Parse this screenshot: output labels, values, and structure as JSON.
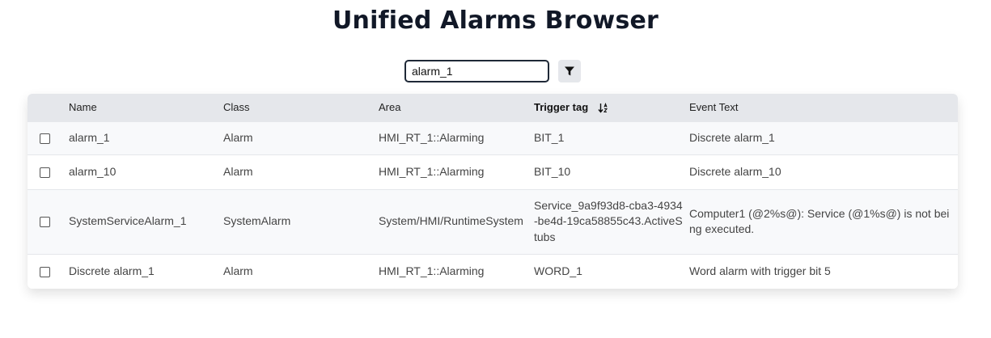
{
  "page": {
    "title": "Unified Alarms Browser"
  },
  "search": {
    "value": "alarm_1"
  },
  "table": {
    "columns": [
      "Name",
      "Class",
      "Area",
      "Trigger tag",
      "Event Text"
    ],
    "sorted_column": "Trigger tag",
    "rows": [
      {
        "name": "alarm_1",
        "class": "Alarm",
        "area": "HMI_RT_1::Alarming",
        "trigger_tag": "BIT_1",
        "event_text": "Discrete alarm_1"
      },
      {
        "name": "alarm_10",
        "class": "Alarm",
        "area": "HMI_RT_1::Alarming",
        "trigger_tag": "BIT_10",
        "event_text": "Discrete alarm_10"
      },
      {
        "name": "SystemServiceAlarm_1",
        "class": "SystemAlarm",
        "area": "System/HMI/RuntimeSystem",
        "trigger_tag": "Service_9a9f93d8-cba3-4934-be4d-19ca58855c43.ActiveStubs",
        "event_text": "Computer1 (@2%s@): Service (@1%s@) is not being executed."
      },
      {
        "name": "Discrete alarm_1",
        "class": "Alarm",
        "area": "HMI_RT_1::Alarming",
        "trigger_tag": "WORD_1",
        "event_text": "Word alarm with trigger bit 5"
      }
    ]
  },
  "colors": {
    "header_bg": "#e5e7eb",
    "row_alt_bg": "#f8f9fb",
    "title": "#111827"
  }
}
